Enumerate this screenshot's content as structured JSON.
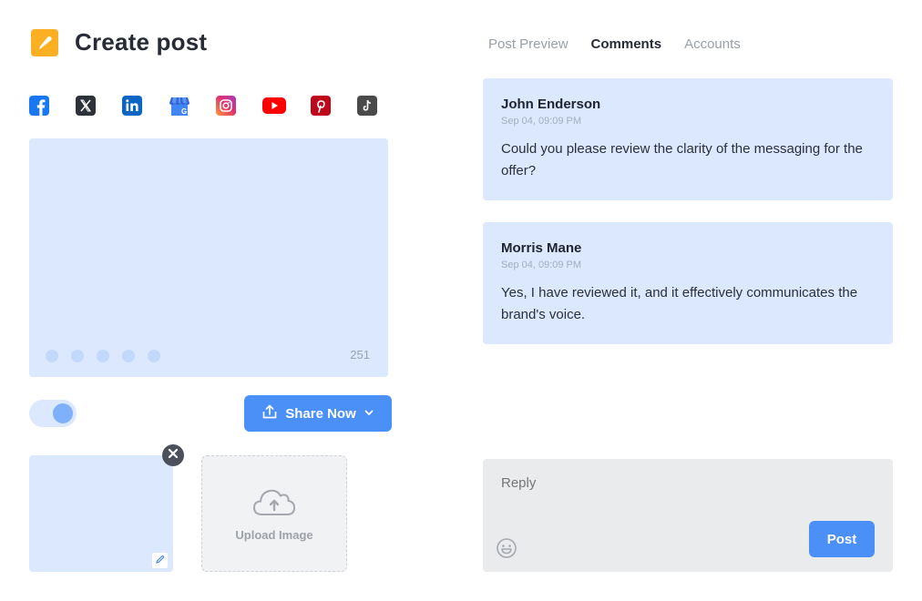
{
  "header": {
    "title": "Create post",
    "logo_icon": "pencil-icon",
    "logo_color": "#fbb024"
  },
  "socials": [
    {
      "name": "facebook",
      "icon": "facebook-icon",
      "color": "#1877f2"
    },
    {
      "name": "x",
      "icon": "x-icon",
      "color": "#2c313a"
    },
    {
      "name": "linkedin",
      "icon": "linkedin-icon",
      "color": "#0a66c2"
    },
    {
      "name": "google-business",
      "icon": "google-business-icon",
      "color": "#4285f4"
    },
    {
      "name": "instagram",
      "icon": "instagram-icon",
      "color": "#e1306c"
    },
    {
      "name": "youtube",
      "icon": "youtube-icon",
      "color": "#ff0000"
    },
    {
      "name": "pinterest",
      "icon": "pinterest-icon",
      "color": "#bd081c"
    },
    {
      "name": "tiktok",
      "icon": "tiktok-icon",
      "color": "#4a4a4a"
    }
  ],
  "preview": {
    "char_count": "251",
    "dot_count": 5
  },
  "toggle": {
    "on": true
  },
  "share_button": {
    "label": "Share Now",
    "icon": "share-upload-icon",
    "dropdown_icon": "chevron-down-icon"
  },
  "upload": {
    "label": "Upload Image",
    "icon": "cloud-upload-icon"
  },
  "tabs": [
    {
      "label": "Post Preview",
      "active": false
    },
    {
      "label": "Comments",
      "active": true
    },
    {
      "label": "Accounts",
      "active": false
    }
  ],
  "comments": [
    {
      "author": "John Enderson",
      "time": "Sep 04, 09:09 PM",
      "text": "Could you please review the clarity of the messaging for the offer?"
    },
    {
      "author": "Morris Mane",
      "time": "Sep 04, 09:09 PM",
      "text": "Yes, I have reviewed it, and it effectively communicates the brand's voice."
    }
  ],
  "reply": {
    "placeholder": "Reply",
    "post_label": "Post"
  },
  "colors": {
    "accent": "#4a90f7",
    "card_bg": "#dbe8fd",
    "reply_bg": "#e9ebed"
  }
}
